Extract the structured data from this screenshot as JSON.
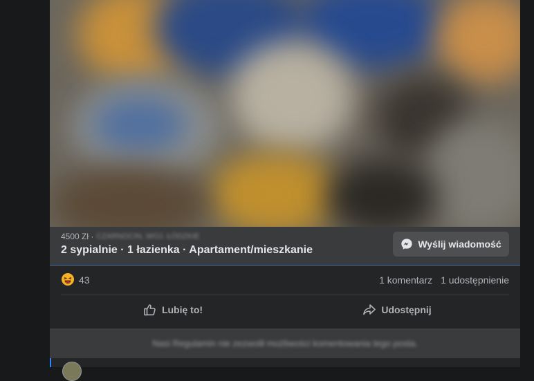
{
  "listing": {
    "price": "4500 Zł ·",
    "location": "CZARNOCIN, WOJ. ŁÓDZKIE",
    "title": "2 sypialnie · 1 łazienka · Apartament/mieszkanie",
    "message_button": "Wyślij wiadomość",
    "message_icon": "messenger-icon"
  },
  "stats": {
    "reaction_icon": "laughing-emoji-icon",
    "reaction_count": "43",
    "comments": "1 komentarz",
    "shares": "1 udostępnienie"
  },
  "actions": {
    "like": "Lubię to!",
    "share": "Udostępnij"
  },
  "comment_notice": "Nasi Regulamin nie zezwolił możliwości komentowania tego posta.",
  "colors": {
    "background": "#18191a",
    "card": "#242526",
    "surface": "#3a3b3c",
    "button": "#4e4f50",
    "accent": "#2d88ff",
    "text": "#e4e6eb",
    "muted": "#b0b3b8"
  }
}
